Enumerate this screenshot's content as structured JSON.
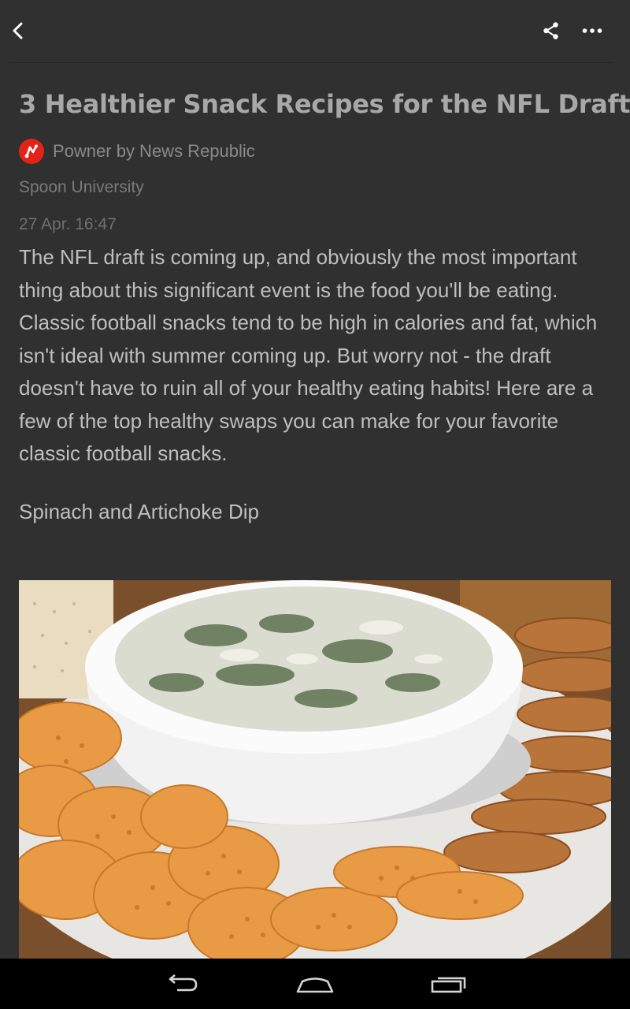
{
  "toolbar": {
    "back_icon": "chevron-left-icon",
    "share_icon": "share-icon",
    "more_icon": "more-horizontal-icon"
  },
  "article": {
    "title": "3 Healthier Snack Recipes for the NFL Draft",
    "powered_by": "Powner by News Republic",
    "source": "Spoon University",
    "date": "27 Apr. 16:47",
    "body": "The NFL draft is coming up, and obviously the most important thing about this significant event is the food you'll be eating. Classic football snacks tend to be high in calories and fat, which isn't ideal with summer coming up. But worry not - the draft doesn't have to ruin all of your healthy eating habits! Here are a few of the top healthy swaps you can make for your favorite classic football snacks.",
    "subheading": "Spinach and Artichoke Dip",
    "image_alt_icon": "spinach-dip-photo"
  },
  "navbar": {
    "back_icon": "nav-back-icon",
    "home_icon": "nav-home-icon",
    "recents_icon": "nav-recents-icon"
  },
  "colors": {
    "background": "#303030",
    "title": "#a8a8a8",
    "body": "#bfbfbf",
    "brand_red": "#e2231a",
    "navbar": "#000000"
  }
}
